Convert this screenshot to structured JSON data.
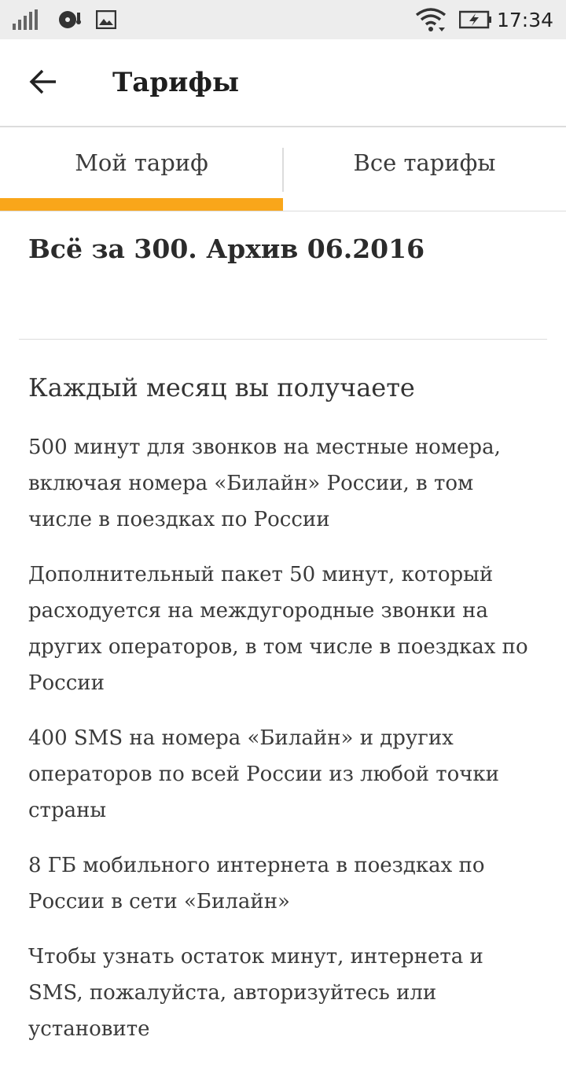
{
  "status_bar": {
    "time": "17:34",
    "icons": [
      "signal-icon",
      "media-icon",
      "image-icon",
      "wifi-icon",
      "battery-charging-icon"
    ]
  },
  "toolbar": {
    "back_icon": "arrow-left-icon",
    "title": "Тарифы"
  },
  "tabs": [
    {
      "label": "Мой тариф",
      "active": true
    },
    {
      "label": "Все тарифы",
      "active": false
    }
  ],
  "colors": {
    "accent": "#f9a61a",
    "status_bar_bg": "#ededed",
    "text": "#3a3a3a"
  },
  "tariff": {
    "name": "Всё за 300. Архив 06.2016"
  },
  "section": {
    "title": "Каждый месяц вы получаете",
    "items": [
      "500 минут для звонков на местные номера, включая номера «Билайн» России, в том числе в поездках по России",
      "Дополнительный пакет 50 минут, который расходуется на междугородные звонки на других операторов, в том числе в поездках по России",
      "400 SMS на номера «Билайн» и других операторов по всей России из любой точки страны",
      "8 ГБ мобильного интернета в поездках по России в сети «Билайн»",
      "Чтобы узнать остаток минут, интернета и SMS, пожалуйста, авторизуйтесь или установите"
    ]
  }
}
